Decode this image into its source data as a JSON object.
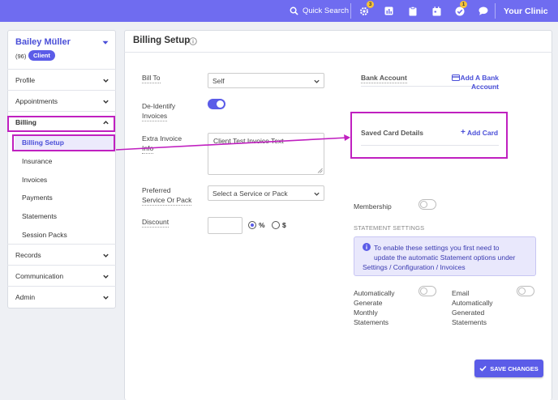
{
  "topbar": {
    "quick_search": "Quick Search",
    "badge_1": "3",
    "badge_2": "1",
    "clinic": "Your Clinic"
  },
  "sidebar": {
    "patient_name": "Bailey Müller",
    "patient_id": "(96)",
    "patient_type": "Client",
    "items": [
      {
        "label": "Profile"
      },
      {
        "label": "Appointments"
      },
      {
        "label": "Billing"
      },
      {
        "label": "Records"
      },
      {
        "label": "Communication"
      },
      {
        "label": "Admin"
      }
    ],
    "billing_sub": [
      {
        "label": "Billing Setup"
      },
      {
        "label": "Insurance"
      },
      {
        "label": "Invoices"
      },
      {
        "label": "Payments"
      },
      {
        "label": "Statements"
      },
      {
        "label": "Session Packs"
      }
    ]
  },
  "main": {
    "title": "Billing Setup",
    "bill_to_label": "Bill To",
    "bill_to_value": "Self",
    "deidentify_label_1": "De-Identify",
    "deidentify_label_2": "Invoices",
    "extra_label_1": "Extra Invoice",
    "extra_label_2": "Info",
    "extra_value": "Client Test Invoice Text",
    "preferred_label_1": "Preferred",
    "preferred_label_2": "Service Or Pack",
    "preferred_value": "Select a Service or Pack",
    "discount_label": "Discount",
    "discount_value": "",
    "discount_pct": "%",
    "discount_dollar": "$",
    "bank_account_label": "Bank Account",
    "add_bank_1": "Add A Bank",
    "add_bank_2": "Account",
    "saved_cards_label": "Saved Card Details",
    "add_card": "Add Card",
    "membership_label": "Membership",
    "statement_heading": "STATEMENT SETTINGS",
    "info_text_1": "To enable these settings you first need to",
    "info_text_2": "update the automatic Statement options under",
    "info_text_3": "Settings / Configuration / Invoices",
    "auto_gen_1": "Automatically",
    "auto_gen_2": "Generate",
    "auto_gen_3": "Monthly",
    "auto_gen_4": "Statements",
    "email_auto_1": "Email",
    "email_auto_2": "Automatically",
    "email_auto_3": "Generated",
    "email_auto_4": "Statements",
    "save_label": "SAVE CHANGES"
  },
  "colors": {
    "accent": "#6f6cf0",
    "highlight": "#c020c0",
    "link": "#4a4fd8"
  }
}
